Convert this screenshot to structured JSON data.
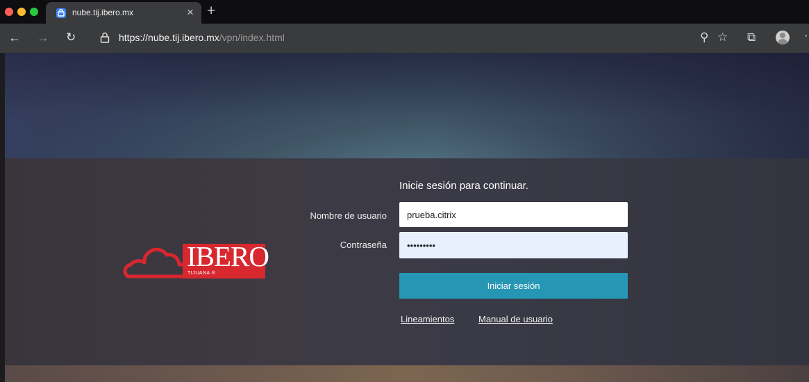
{
  "browser": {
    "tab": {
      "title": "nube.tij.ibero.mx",
      "close_glyph": "×"
    },
    "new_tab_glyph": "+",
    "nav": {
      "back": "←",
      "forward": "→",
      "reload": "↻"
    },
    "url": {
      "scheme": "https://",
      "host": "nube.tij.ibero.mx",
      "path": "/vpn/index.html"
    },
    "toolbar": {
      "key": "⚲",
      "star": "☆",
      "collections": "⧉",
      "more": "⋯"
    },
    "traffic_colors": {
      "close": "#ff5f57",
      "minimize": "#febc2e",
      "zoom": "#28c840"
    }
  },
  "logo": {
    "word": "IBERO",
    "subtitle": "TIJUANA ®",
    "color": "#d7282f"
  },
  "login": {
    "title": "Inicie sesión para continuar.",
    "username_label": "Nombre de usuario",
    "username_value": "prueba.citrix",
    "password_label": "Contraseña",
    "password_value": "•••••••••",
    "submit_label": "Iniciar sesión",
    "submit_color": "#2596b3"
  },
  "links": {
    "guidelines": "Lineamientos",
    "manual": "Manual de usuario"
  }
}
